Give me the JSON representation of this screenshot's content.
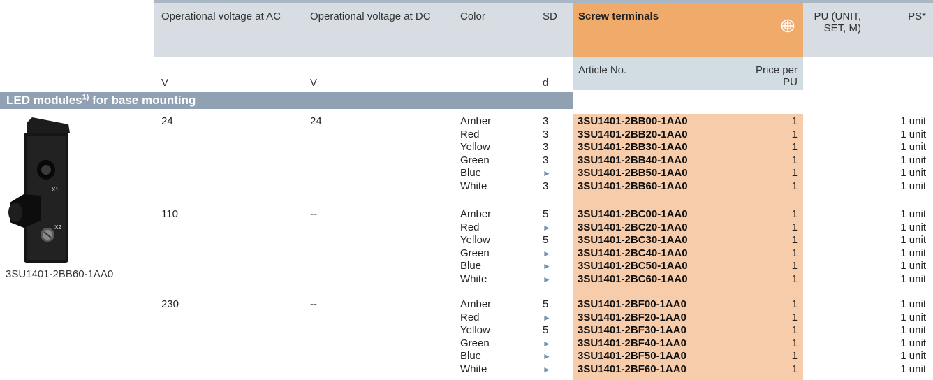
{
  "header": {
    "ac_label": "Operational voltage at AC",
    "dc_label": "Operational voltage at DC",
    "color_label": "Color",
    "sd_label": "SD",
    "screw_label": "Screw terminals",
    "screw_icon": "screw-terminal-icon",
    "pu_label": "PU (UNIT, SET, M)",
    "ps_label": "PS*",
    "ac_unit": "V",
    "dc_unit": "V",
    "sd_unit": "d",
    "article_label": "Article No.",
    "price_label": "Price per PU"
  },
  "section": {
    "title": "LED modules",
    "superscript": "1)",
    "suffix": " for base mounting"
  },
  "image_caption": "3SU1401-2BB60-1AA0",
  "groups": [
    {
      "ac": "24",
      "dc": "24",
      "rows": [
        {
          "color": "Amber",
          "sd": "3",
          "article": "3SU1401-2BB00-1AA0",
          "pu": "1",
          "ps": "1 unit"
        },
        {
          "color": "Red",
          "sd": "3",
          "article": "3SU1401-2BB20-1AA0",
          "pu": "1",
          "ps": "1 unit"
        },
        {
          "color": "Yellow",
          "sd": "3",
          "article": "3SU1401-2BB30-1AA0",
          "pu": "1",
          "ps": "1 unit"
        },
        {
          "color": "Green",
          "sd": "3",
          "article": "3SU1401-2BB40-1AA0",
          "pu": "1",
          "ps": "1 unit"
        },
        {
          "color": "Blue",
          "sd": "►",
          "article": "3SU1401-2BB50-1AA0",
          "pu": "1",
          "ps": "1 unit"
        },
        {
          "color": "White",
          "sd": "3",
          "article": "3SU1401-2BB60-1AA0",
          "pu": "1",
          "ps": "1 unit"
        }
      ]
    },
    {
      "ac": "110",
      "dc": "--",
      "rows": [
        {
          "color": "Amber",
          "sd": "5",
          "article": "3SU1401-2BC00-1AA0",
          "pu": "1",
          "ps": "1 unit"
        },
        {
          "color": "Red",
          "sd": "►",
          "article": "3SU1401-2BC20-1AA0",
          "pu": "1",
          "ps": "1 unit"
        },
        {
          "color": "Yellow",
          "sd": "5",
          "article": "3SU1401-2BC30-1AA0",
          "pu": "1",
          "ps": "1 unit"
        },
        {
          "color": "Green",
          "sd": "►",
          "article": "3SU1401-2BC40-1AA0",
          "pu": "1",
          "ps": "1 unit"
        },
        {
          "color": "Blue",
          "sd": "►",
          "article": "3SU1401-2BC50-1AA0",
          "pu": "1",
          "ps": "1 unit"
        },
        {
          "color": "White",
          "sd": "►",
          "article": "3SU1401-2BC60-1AA0",
          "pu": "1",
          "ps": "1 unit"
        }
      ]
    },
    {
      "ac": "230",
      "dc": "--",
      "rows": [
        {
          "color": "Amber",
          "sd": "5",
          "article": "3SU1401-2BF00-1AA0",
          "pu": "1",
          "ps": "1 unit"
        },
        {
          "color": "Red",
          "sd": "►",
          "article": "3SU1401-2BF20-1AA0",
          "pu": "1",
          "ps": "1 unit"
        },
        {
          "color": "Yellow",
          "sd": "5",
          "article": "3SU1401-2BF30-1AA0",
          "pu": "1",
          "ps": "1 unit"
        },
        {
          "color": "Green",
          "sd": "►",
          "article": "3SU1401-2BF40-1AA0",
          "pu": "1",
          "ps": "1 unit"
        },
        {
          "color": "Blue",
          "sd": "►",
          "article": "3SU1401-2BF50-1AA0",
          "pu": "1",
          "ps": "1 unit"
        },
        {
          "color": "White",
          "sd": "►",
          "article": "3SU1401-2BF60-1AA0",
          "pu": "1",
          "ps": "1 unit"
        }
      ]
    }
  ]
}
